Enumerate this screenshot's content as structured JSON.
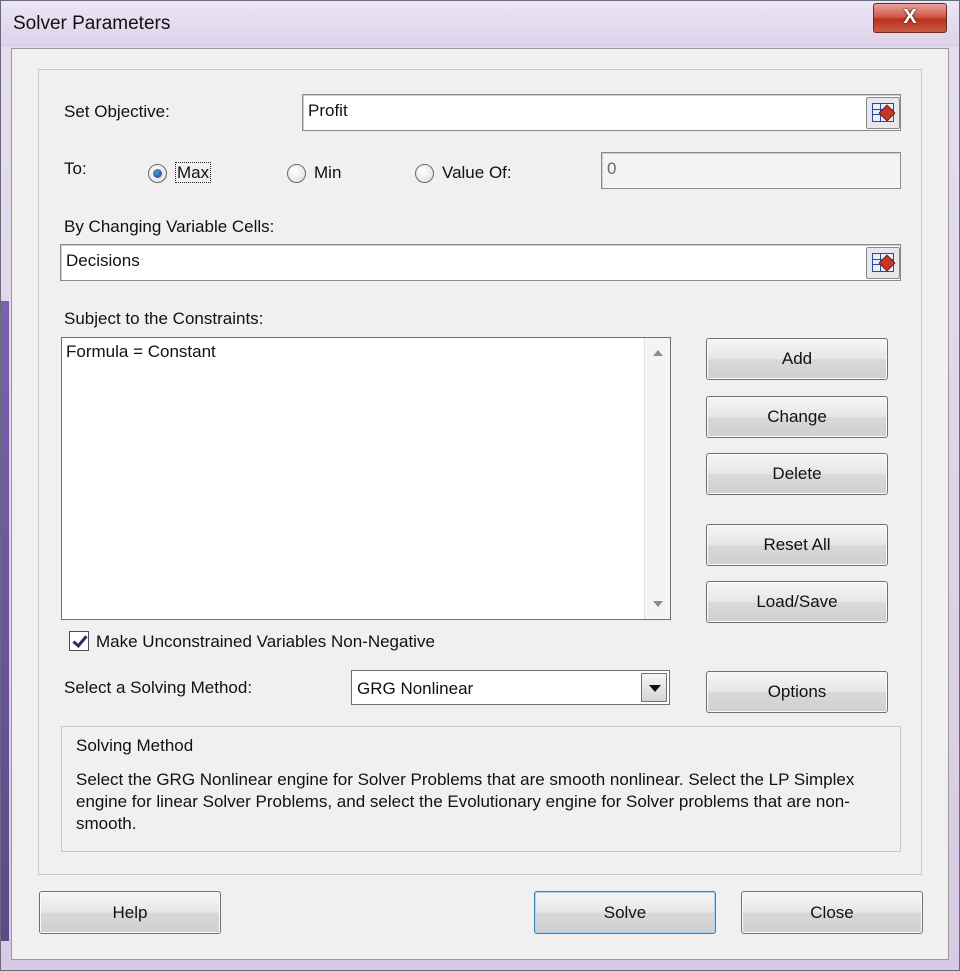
{
  "window": {
    "title": "Solver Parameters",
    "close_glyph": "X"
  },
  "objective": {
    "label": "Set Objective:",
    "value": "Profit"
  },
  "to": {
    "label": "To:",
    "options": [
      {
        "label": "Max",
        "checked": true
      },
      {
        "label": "Min",
        "checked": false
      },
      {
        "label": "Value Of:",
        "checked": false
      }
    ],
    "value_of": "0"
  },
  "variables": {
    "label": "By Changing Variable Cells:",
    "value": "Decisions"
  },
  "constraints": {
    "label": "Subject to the Constraints:",
    "items": [
      "Formula = Constant"
    ]
  },
  "side_buttons": {
    "add": "Add",
    "change": "Change",
    "delete": "Delete",
    "reset_all": "Reset All",
    "load_save": "Load/Save",
    "options": "Options"
  },
  "nonnegative": {
    "label": "Make Unconstrained Variables Non-Negative",
    "checked": true
  },
  "method": {
    "label": "Select a Solving Method:",
    "selected": "GRG Nonlinear",
    "box_title": "Solving Method",
    "description": "Select the GRG Nonlinear engine for Solver Problems that are smooth nonlinear. Select the LP Simplex engine for linear Solver Problems, and select the Evolutionary engine for Solver problems that are non-smooth."
  },
  "footer": {
    "help": "Help",
    "solve": "Solve",
    "close": "Close"
  },
  "icons": {
    "close": "close-icon",
    "refedit": "range-select-icon",
    "dropdown": "chevron-down-icon",
    "scroll_up": "scroll-up-icon",
    "scroll_down": "scroll-down-icon"
  },
  "colors": {
    "frame": "#d6cbe4",
    "accent": "#3c7fb1",
    "close": "#c0392b"
  }
}
